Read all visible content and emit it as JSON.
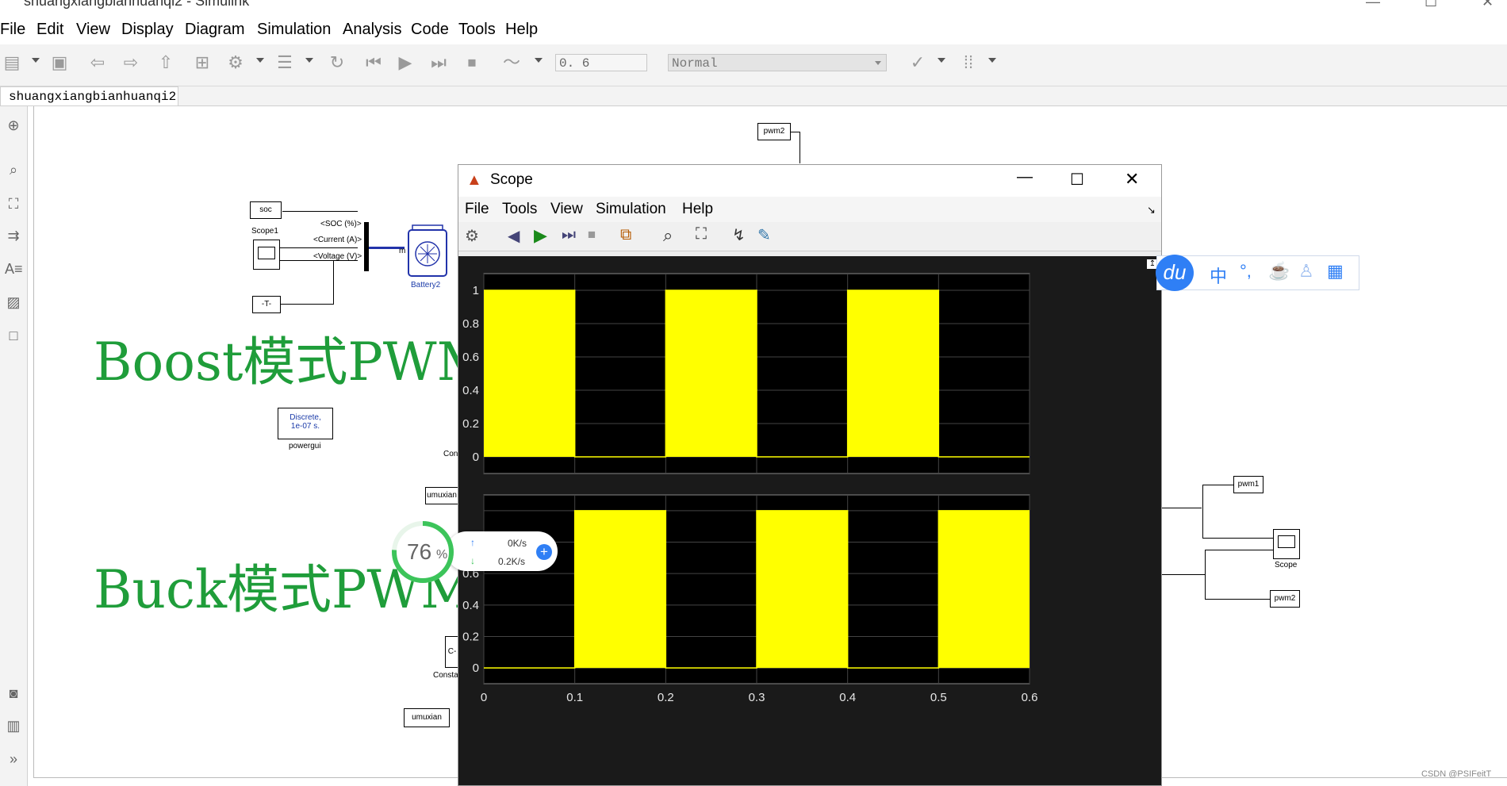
{
  "window": {
    "title": "shuangxiangbianhuanqi2 - Simulink"
  },
  "menu": [
    "File",
    "Edit",
    "View",
    "Display",
    "Diagram",
    "Simulation",
    "Analysis",
    "Code",
    "Tools",
    "Help"
  ],
  "toolbar": {
    "stop_time": "0. 6",
    "sim_mode": "Normal"
  },
  "tab": {
    "label": "shuangxiangbianhuanqi2"
  },
  "diagram": {
    "goto_pwm2_top": "pwm2",
    "from_soc": "soc",
    "scope1_label": "Scope1",
    "from_T": "-T-",
    "bus_soc": "<SOC (%)>",
    "bus_current": "<Current (A)>",
    "bus_voltage": "<Voltage (V)>",
    "battery_label": "Battery2",
    "battery_m": "m",
    "powergui_line1": "Discrete,",
    "powergui_line2": "1e-07 s.",
    "powergui_label": "powergui",
    "cons_partial": "Con",
    "from_umuxian1": "umuxian",
    "const_c": "C-",
    "const_label": "Consta",
    "from_umuxian2": "umuxian",
    "goto_pwm1": "pwm1",
    "scope_label": "Scope",
    "goto_pwm2": "pwm2",
    "boost_text": "Boost模式PWM",
    "buck_text": "Buck模式PWM"
  },
  "scope": {
    "title": "Scope",
    "menu": [
      "File",
      "Tools",
      "View",
      "Simulation",
      "Help"
    ]
  },
  "chart_data": [
    {
      "type": "line",
      "title": "",
      "series": [
        {
          "x": [
            0,
            0.1,
            0.1,
            0.2,
            0.2,
            0.3,
            0.3,
            0.4,
            0.4,
            0.5,
            0.5,
            0.6
          ],
          "values": [
            1,
            1,
            0,
            0,
            1,
            1,
            0,
            0,
            1,
            1,
            0,
            0
          ]
        }
      ],
      "xlim": [
        0,
        0.6
      ],
      "ylim": [
        -0.1,
        1.1
      ],
      "yticks": [
        "1",
        "0.8",
        "0.6",
        "0.4",
        "0.2",
        "0"
      ],
      "grid": true,
      "line_color": "#ffff00",
      "background": "#000000"
    },
    {
      "type": "line",
      "title": "",
      "series": [
        {
          "x": [
            0,
            0.1,
            0.1,
            0.2,
            0.2,
            0.3,
            0.3,
            0.4,
            0.4,
            0.5,
            0.5,
            0.6
          ],
          "values": [
            0,
            0,
            1,
            1,
            0,
            0,
            1,
            1,
            0,
            0,
            1,
            1
          ]
        }
      ],
      "xlim": [
        0,
        0.6
      ],
      "ylim": [
        -0.1,
        1.1
      ],
      "yticks": [
        "0.8",
        "0.6",
        "0.4",
        "0.2",
        "0"
      ],
      "xticks": [
        "0",
        "0.1",
        "0.2",
        "0.3",
        "0.4",
        "0.5",
        "0.6"
      ],
      "grid": true,
      "line_color": "#ffff00",
      "background": "#000000"
    }
  ],
  "overlays": {
    "baidu_logo": "du",
    "baidu_items": [
      "中",
      "°,"
    ],
    "net_percent": "76",
    "net_percent_sign": "%",
    "net_up": "0K/s",
    "net_down": "0.2K/s"
  },
  "watermark": "CSDN @PSIFeitT",
  "colors": {
    "accent_green": "#1f9d3a",
    "signal_yellow": "#ffff00",
    "baidu_blue": "#2f7ff5"
  }
}
